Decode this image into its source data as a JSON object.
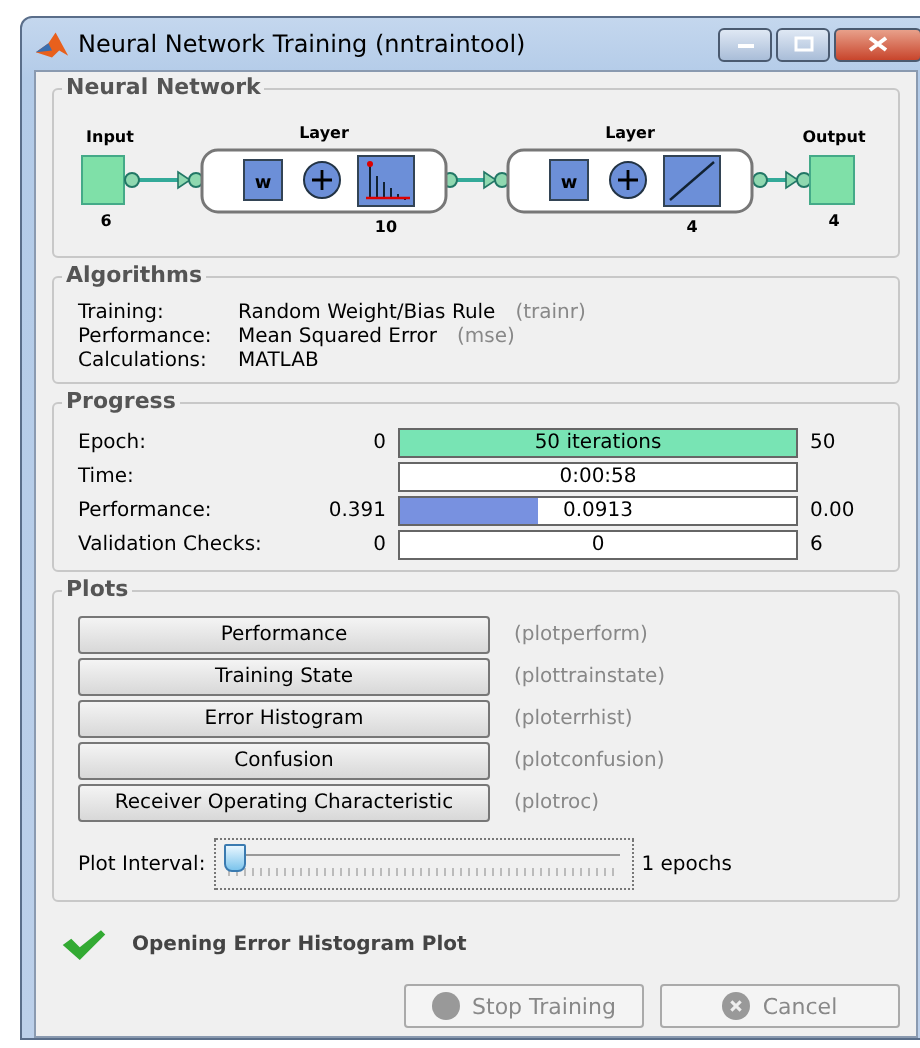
{
  "window": {
    "title": "Neural Network Training (nntraintool)"
  },
  "network": {
    "title": "Neural Network",
    "input": {
      "label": "Input",
      "size": "6"
    },
    "layers": [
      {
        "label": "Layer",
        "weight": "w",
        "size": "10",
        "kind": "bars"
      },
      {
        "label": "Layer",
        "weight": "w",
        "size": "4",
        "kind": "linear"
      }
    ],
    "output": {
      "label": "Output",
      "size": "4"
    }
  },
  "algorithms": {
    "title": "Algorithms",
    "rows": [
      {
        "label": "Training:",
        "value": "Random Weight/Bias Rule",
        "code": "(trainr)"
      },
      {
        "label": "Performance:",
        "value": "Mean Squared Error",
        "code": "(mse)"
      },
      {
        "label": "Calculations:",
        "value": "MATLAB"
      }
    ]
  },
  "progress": {
    "title": "Progress",
    "rows": [
      {
        "label": "Epoch:",
        "start": "0",
        "text": "50 iterations",
        "end": "50",
        "level": 1,
        "kind": "green"
      },
      {
        "label": "Time:",
        "text": "0:00:58"
      },
      {
        "label": "Performance:",
        "start": "0.391",
        "text": "0.0913",
        "end": "0.00",
        "level": 0.35,
        "kind": "blue"
      },
      {
        "label": "Validation Checks:",
        "start": "0",
        "text": "0",
        "end": "6"
      }
    ]
  },
  "plots": {
    "title": "Plots",
    "buttons": [
      {
        "label": "Performance",
        "code": "(plotperform)"
      },
      {
        "label": "Training State",
        "code": "(plottrainstate)"
      },
      {
        "label": "Error Histogram",
        "code": "(ploterrhist)"
      },
      {
        "label": "Confusion",
        "code": "(plotconfusion)"
      },
      {
        "label": "Receiver Operating Characteristic",
        "code": "(plotroc)"
      }
    ],
    "interval": {
      "label": "Plot Interval:",
      "level": 0,
      "reading": "1 epochs"
    }
  },
  "status": {
    "text": "Opening Error Histogram Plot"
  },
  "buttons": [
    {
      "label": "Stop Training",
      "disabled": true
    },
    {
      "label": "Cancel",
      "disabled": true
    }
  ]
}
